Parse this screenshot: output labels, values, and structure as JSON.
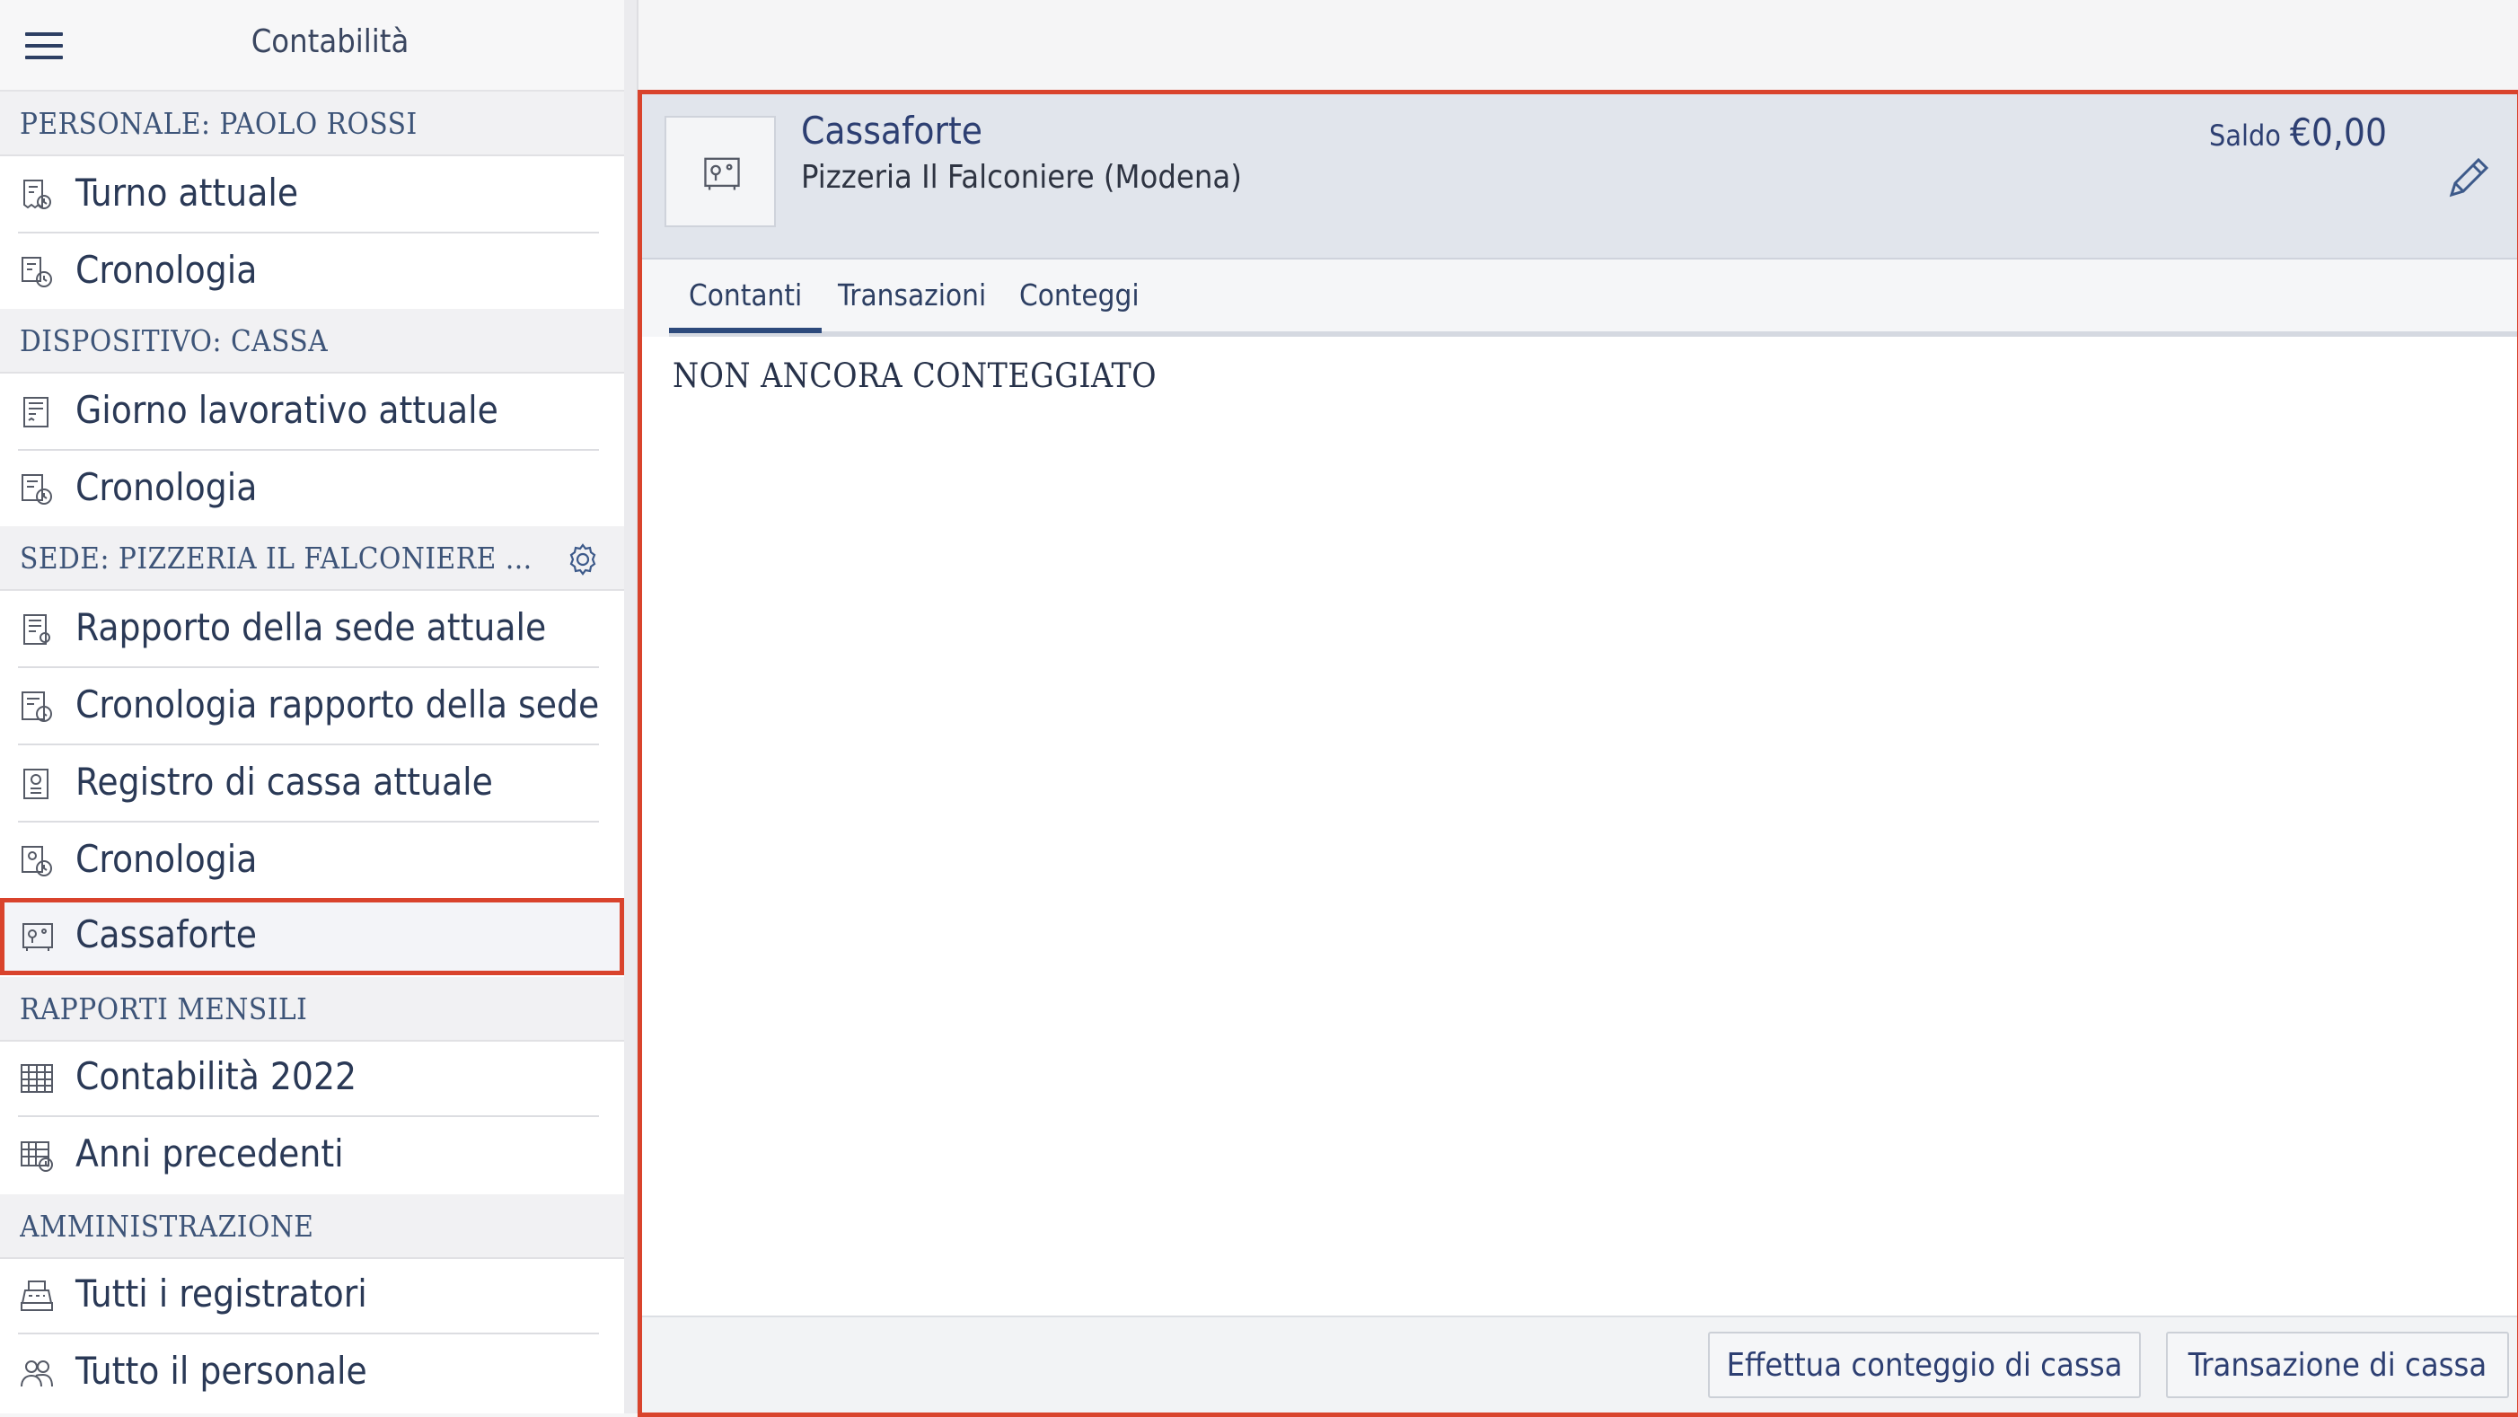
{
  "sidebar": {
    "title": "Contabilità",
    "sections": [
      {
        "label": "PERSONALE: PAOLO ROSSI",
        "items": [
          {
            "label": "Turno attuale",
            "icon": "shift-receipt-icon"
          },
          {
            "label": "Cronologia",
            "icon": "history-icon"
          }
        ]
      },
      {
        "label": "DISPOSITIVO: CASSA",
        "items": [
          {
            "label": "Giorno lavorativo attuale",
            "icon": "receipt-icon"
          },
          {
            "label": "Cronologia",
            "icon": "history-icon"
          }
        ]
      },
      {
        "label": "SEDE: PIZZERIA IL FALCONIERE (MOD...",
        "has_settings": true,
        "items": [
          {
            "label": "Rapporto della sede attuale",
            "icon": "location-report-icon"
          },
          {
            "label": "Cronologia rapporto della sede",
            "icon": "history-icon"
          },
          {
            "label": "Registro di cassa attuale",
            "icon": "cash-register-icon"
          },
          {
            "label": "Cronologia",
            "icon": "history-icon"
          },
          {
            "label": "Cassaforte",
            "icon": "safe-icon",
            "selected": true
          }
        ]
      },
      {
        "label": "RAPPORTI MENSILI",
        "items": [
          {
            "label": "Contabilità 2022",
            "icon": "calendar-icon"
          },
          {
            "label": "Anni precedenti",
            "icon": "calendar-history-icon"
          }
        ]
      },
      {
        "label": "AMMINISTRAZIONE",
        "items": [
          {
            "label": "Tutti i registratori",
            "icon": "cash-machine-icon"
          },
          {
            "label": "Tutto il personale",
            "icon": "people-icon"
          }
        ]
      }
    ]
  },
  "main": {
    "title": "Cassaforte",
    "subtitle": "Pizzeria Il Falconiere (Modena)",
    "balance_label": "Saldo",
    "balance_value": "€0,00",
    "tabs": [
      {
        "label": "Contanti",
        "active": true
      },
      {
        "label": "Transazioni",
        "active": false
      },
      {
        "label": "Conteggi",
        "active": false
      }
    ],
    "status": "NON ANCORA CONTEGGIATO",
    "footer": {
      "count_button": "Effettua conteggio di cassa",
      "transaction_button": "Transazione di cassa"
    }
  },
  "colors": {
    "accent": "#2d4a7c",
    "highlight_border": "#d9432c",
    "header_bg": "#e1e5ec"
  }
}
